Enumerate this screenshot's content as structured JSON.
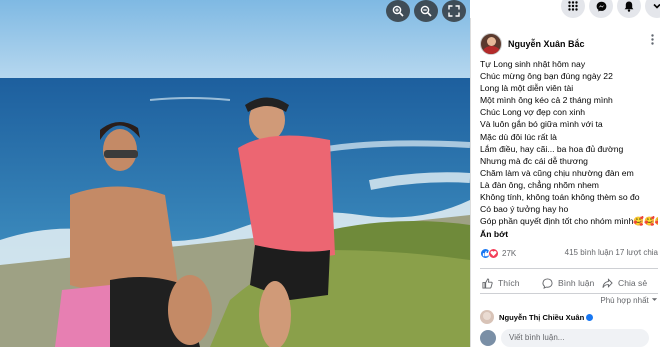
{
  "post": {
    "author": "Nguyễn Xuân Bắc",
    "lines": [
      "Tự Long sinh nhật hôm nay",
      "Chúc mừng ông bạn đúng ngày 22",
      "Long là một diễn viên tài",
      "Một mình ông kéo cả 2 tháng mình",
      "Chúc Long vợ đẹp con xinh",
      "Và luôn gắn bó giữa mình với ta",
      "Mặc dù đôi lúc rất là",
      "Lắm điều, hay cãi... ba hoa đủ đường",
      "Nhưng mà đc cái dễ thương",
      "Chăm làm và cũng chịu nhường đàn em",
      "Là đàn ông, chẳng nhõm nhem",
      "Không tính, không toán không thèm so đo",
      "Có bao ý tưởng hay ho",
      "Góp phần quyết định tốt cho nhóm mình🥰🥰🥰"
    ],
    "see_less": "Ẩn bớt"
  },
  "stats": {
    "reaction_count": "27K",
    "comments_shares": "415 bình luận  17 lượt chia"
  },
  "actions": {
    "like": "Thích",
    "comment": "Bình luận",
    "share": "Chia sẻ"
  },
  "comments": {
    "sort_label": "Phù hợp nhất",
    "first_commenter": "Nguyễn Thị Chiều Xuân",
    "input_placeholder": "Viết bình luận..."
  },
  "icons": {
    "zoom_in": "zoom-in-icon",
    "zoom_out": "zoom-out-icon",
    "fullscreen": "fullscreen-icon",
    "menu": "grid-menu-icon",
    "messenger": "messenger-icon",
    "notifications": "bell-icon",
    "account": "chevron-down-icon"
  },
  "colors": {
    "accent": "#1877f2",
    "love": "#f33e58",
    "text": "#050505",
    "secondary": "#65676b"
  }
}
